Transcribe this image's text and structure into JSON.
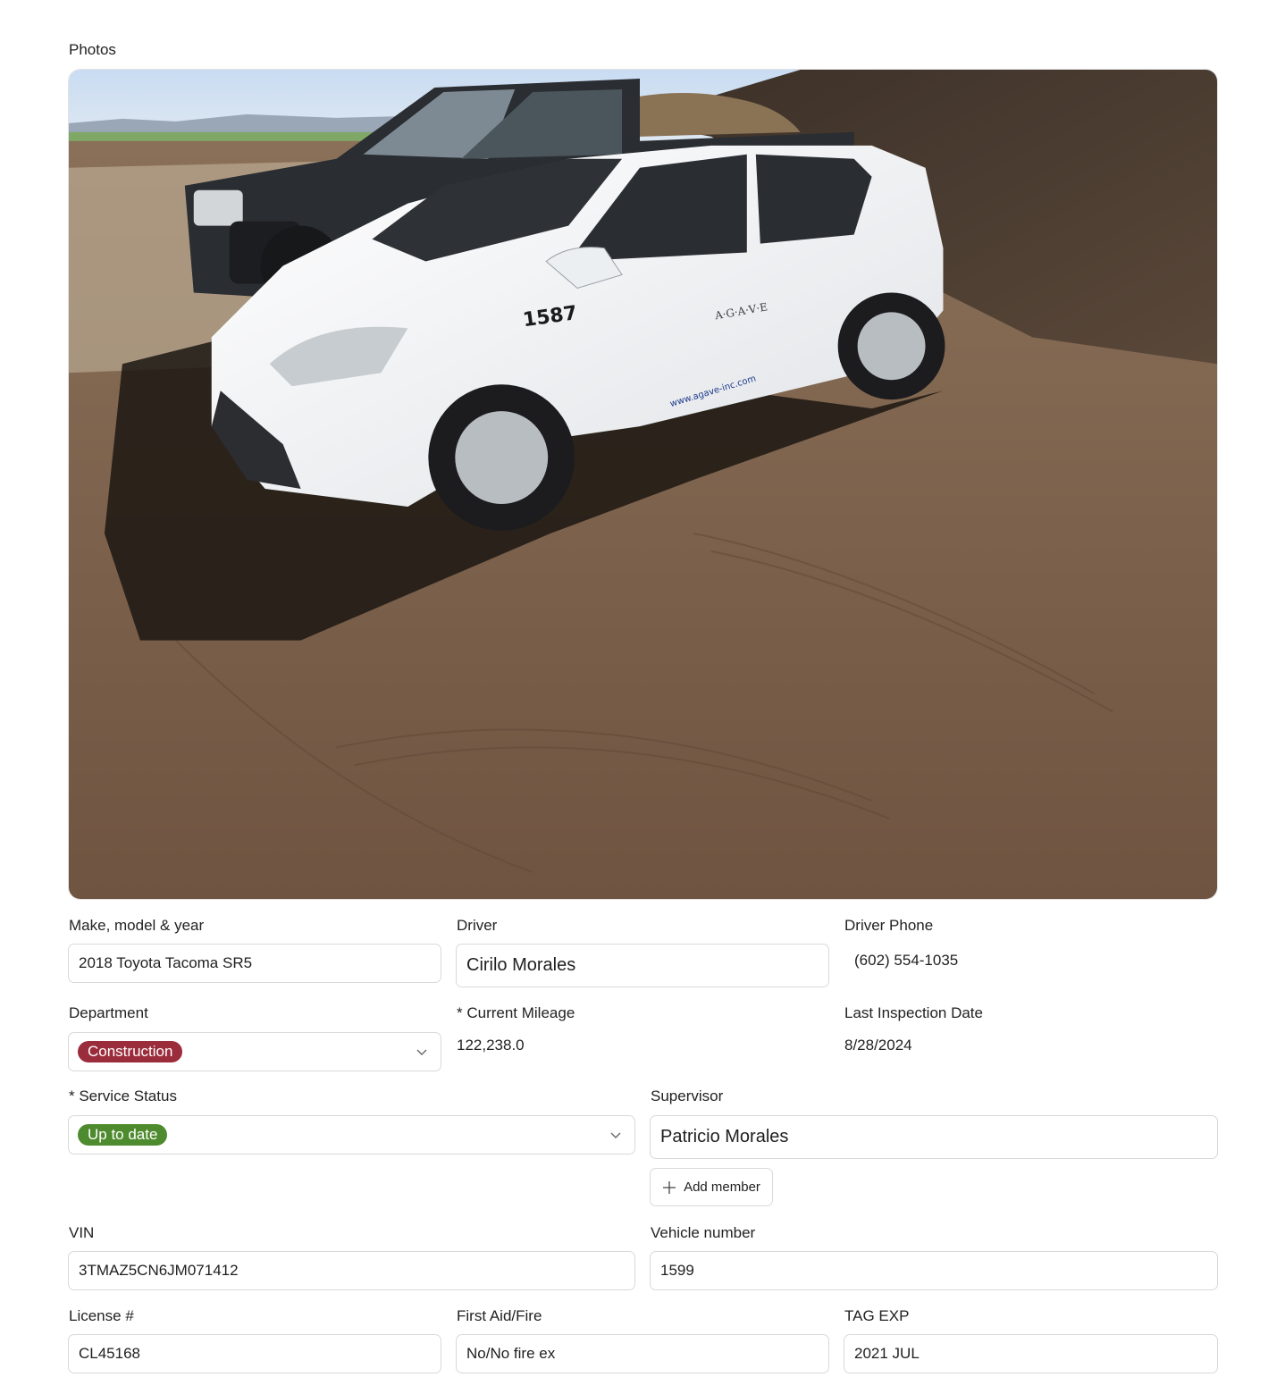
{
  "section": {
    "photos_label": "Photos"
  },
  "photo": {
    "car_number": "1587",
    "brand_text": "A·G·A·V·E",
    "site_text": "www.agave-inc.com"
  },
  "fields": {
    "make_model_year": {
      "label": "Make, model & year",
      "value": "2018 Toyota Tacoma SR5"
    },
    "driver": {
      "label": "Driver",
      "value": "Cirilo Morales"
    },
    "driver_phone": {
      "label": "Driver Phone",
      "value": "(602) 554-1035"
    },
    "department": {
      "label": "Department",
      "value": "Construction",
      "color": "#9b2c3c"
    },
    "current_mileage": {
      "label": "* Current Mileage",
      "value": "122,238.0"
    },
    "last_inspection": {
      "label": "Last Inspection Date",
      "value": "8/28/2024"
    },
    "service_status": {
      "label": "* Service Status",
      "value": "Up to date",
      "color": "#4e8a2e"
    },
    "supervisor": {
      "label": "Supervisor",
      "value": "Patricio Morales",
      "add_label": "Add member"
    },
    "vin": {
      "label": "VIN",
      "value": "3TMAZ5CN6JM071412"
    },
    "vehicle_number": {
      "label": "Vehicle number",
      "value": "1599"
    },
    "license": {
      "label": "License #",
      "value": "CL45168"
    },
    "first_aid": {
      "label": "First Aid/Fire",
      "value": "No/No fire ex"
    },
    "tag_exp": {
      "label": "TAG EXP",
      "value": "2021 JUL"
    }
  },
  "icons": {
    "chevron": "chevron-down-icon",
    "plus": "plus-icon"
  }
}
